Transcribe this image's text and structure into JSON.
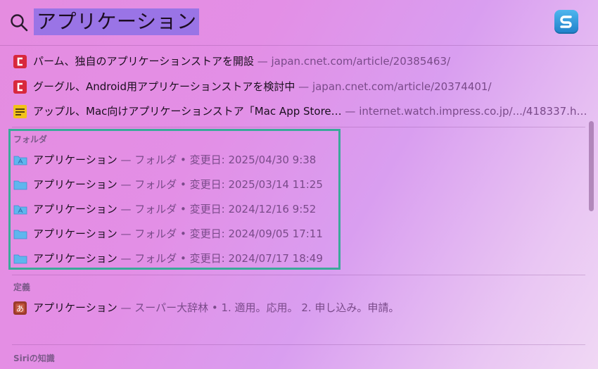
{
  "search": {
    "query": "アプリケーション"
  },
  "web_results": [
    {
      "title": "パーム、独自のアプリケーションストアを開設",
      "source": " — japan.cnet.com/article/20385463/",
      "icon": "cnet-icon"
    },
    {
      "title": "グーグル、Android用アプリケーションストアを検討中",
      "source": " — japan.cnet.com/article/20374401/",
      "icon": "cnet-icon"
    },
    {
      "title": "アップル、Mac向けアプリケーションストア「Mac App Store…",
      "source": " — internet.watch.impress.co.jp/.../418337.h…",
      "icon": "impress-watch-icon"
    }
  ],
  "folders_section": {
    "label": "フォルダ",
    "items": [
      {
        "name": "アプリケーション",
        "meta": " — フォルダ • 変更日: 2025/04/30 9:38",
        "icon": "applications-folder-icon"
      },
      {
        "name": "アプリケーション",
        "meta": " — フォルダ • 変更日: 2025/03/14 11:25",
        "icon": "folder-icon"
      },
      {
        "name": "アプリケーション",
        "meta": " — フォルダ • 変更日: 2024/12/16 9:52",
        "icon": "applications-folder-icon"
      },
      {
        "name": "アプリケーション",
        "meta": " — フォルダ • 変更日: 2024/09/05 17:11",
        "icon": "folder-icon"
      },
      {
        "name": "アプリケーション",
        "meta": " — フォルダ • 変更日: 2024/07/17 18:49",
        "icon": "folder-icon"
      }
    ]
  },
  "definition_section": {
    "label": "定義",
    "item": {
      "name": "アプリケーション",
      "meta": " — スーパー大辞林 • 1. 適用。応用。 2. 申し込み。申請。",
      "icon": "dictionary-icon"
    }
  },
  "siri_section": {
    "label": "Siriの知識"
  },
  "colors": {
    "highlight_border": "#3aa99a",
    "query_selection": "#9a74e6",
    "cnet_red": "#d8283c"
  }
}
